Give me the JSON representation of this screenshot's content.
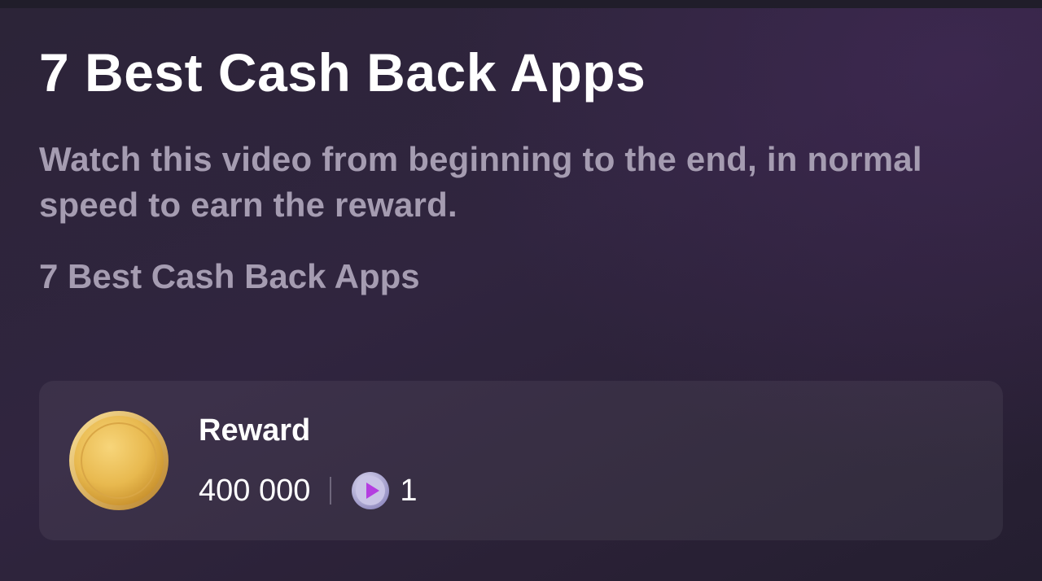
{
  "video": {
    "title": "7 Best Cash Back Apps",
    "description": "Watch this video from beginning to the end, in normal speed to earn the reward.",
    "subtitle": "7 Best Cash Back Apps"
  },
  "reward": {
    "label": "Reward",
    "amount": "400 000",
    "views": "1",
    "coin_icon": "gold-coin-icon",
    "play_icon": "play-icon"
  },
  "colors": {
    "background": "#2c2438",
    "title": "#ffffff",
    "muted_text": "#a59cb1",
    "coin": "#e8b94f",
    "play_accent": "#b43ee0"
  }
}
